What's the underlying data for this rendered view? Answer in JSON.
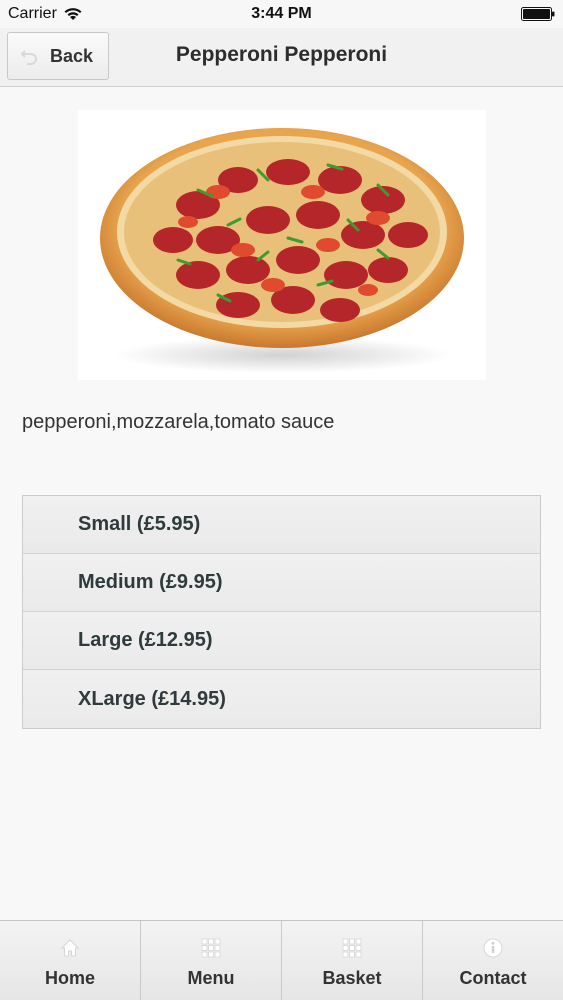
{
  "status_bar": {
    "carrier": "Carrier",
    "time": "3:44 PM"
  },
  "header": {
    "back_label": "Back",
    "title": "Pepperoni Pepperoni"
  },
  "product": {
    "image_name": "pepperoni-pizza",
    "description": "pepperoni,mozzarela,tomato sauce"
  },
  "sizes": [
    {
      "label": "Small (£5.95)"
    },
    {
      "label": "Medium (£9.95)"
    },
    {
      "label": "Large (£12.95)"
    },
    {
      "label": "XLarge (£14.95)"
    }
  ],
  "tabs": [
    {
      "label": "Home",
      "icon": "home-icon"
    },
    {
      "label": "Menu",
      "icon": "grid-icon"
    },
    {
      "label": "Basket",
      "icon": "grid-icon"
    },
    {
      "label": "Contact",
      "icon": "info-icon"
    }
  ]
}
